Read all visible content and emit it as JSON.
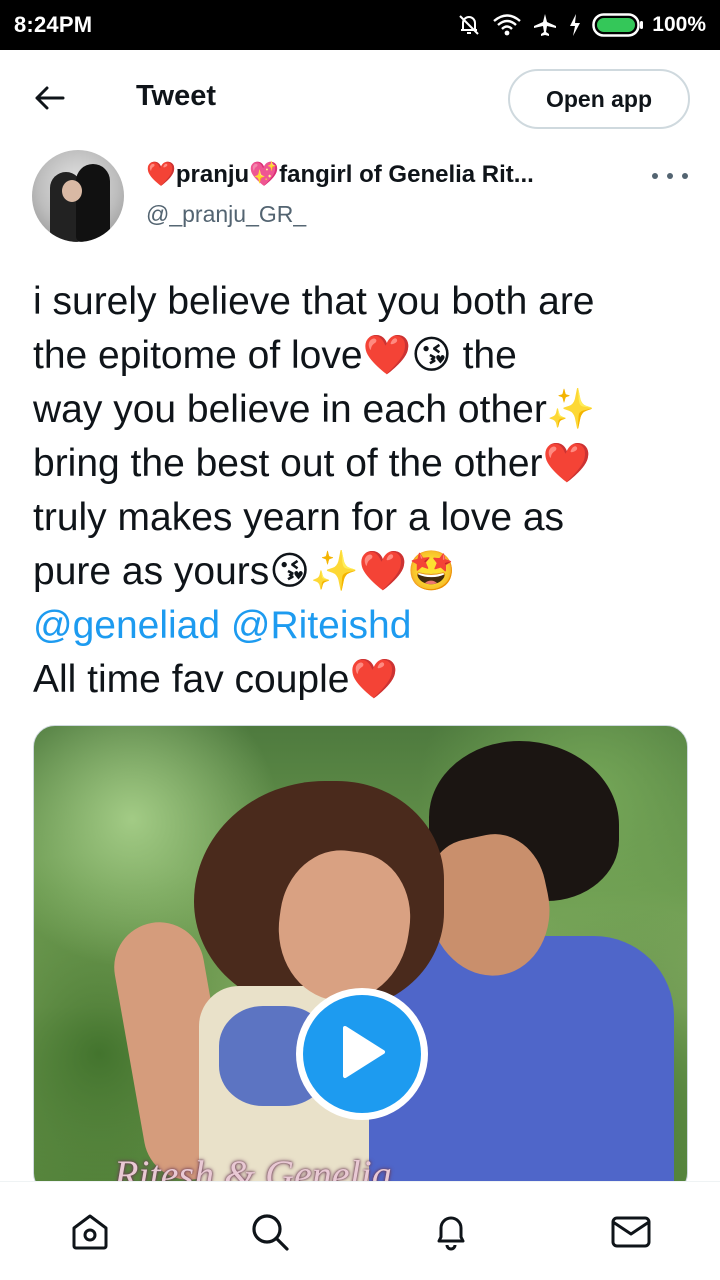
{
  "status_bar": {
    "time": "8:24PM",
    "battery_percent": "100%",
    "icons": [
      "mute-bell-icon",
      "wifi-icon",
      "airplane-icon",
      "charging-icon",
      "battery-icon"
    ]
  },
  "header": {
    "title": "Tweet",
    "open_app_label": "Open app",
    "back_icon": "back-arrow-icon"
  },
  "author": {
    "name": "❤️pranju💖fangirl of Genelia Rit...",
    "handle": "@_pranju_GR_",
    "more_icon": "more-dots-icon"
  },
  "tweet": {
    "text": "i surely believe that you both are\nthe epitome of love❤️😘 the\nway you believe in each other✨\nbring the best out of the other❤️\ntruly makes yearn for a love as\npure as yours😘✨❤️🤩",
    "mentions": [
      "@geneliad",
      "@Riteishd"
    ],
    "last_line": "All time fav couple❤️"
  },
  "media": {
    "caption": "Ritesh & Genelia",
    "play_icon": "play-icon"
  },
  "bottom_nav": {
    "items": [
      "home-icon",
      "search-icon",
      "notifications-icon",
      "messages-icon"
    ]
  },
  "colors": {
    "link": "#1d9bf0",
    "text": "#0f1419",
    "secondary": "#536471",
    "border": "#cfd9de"
  }
}
